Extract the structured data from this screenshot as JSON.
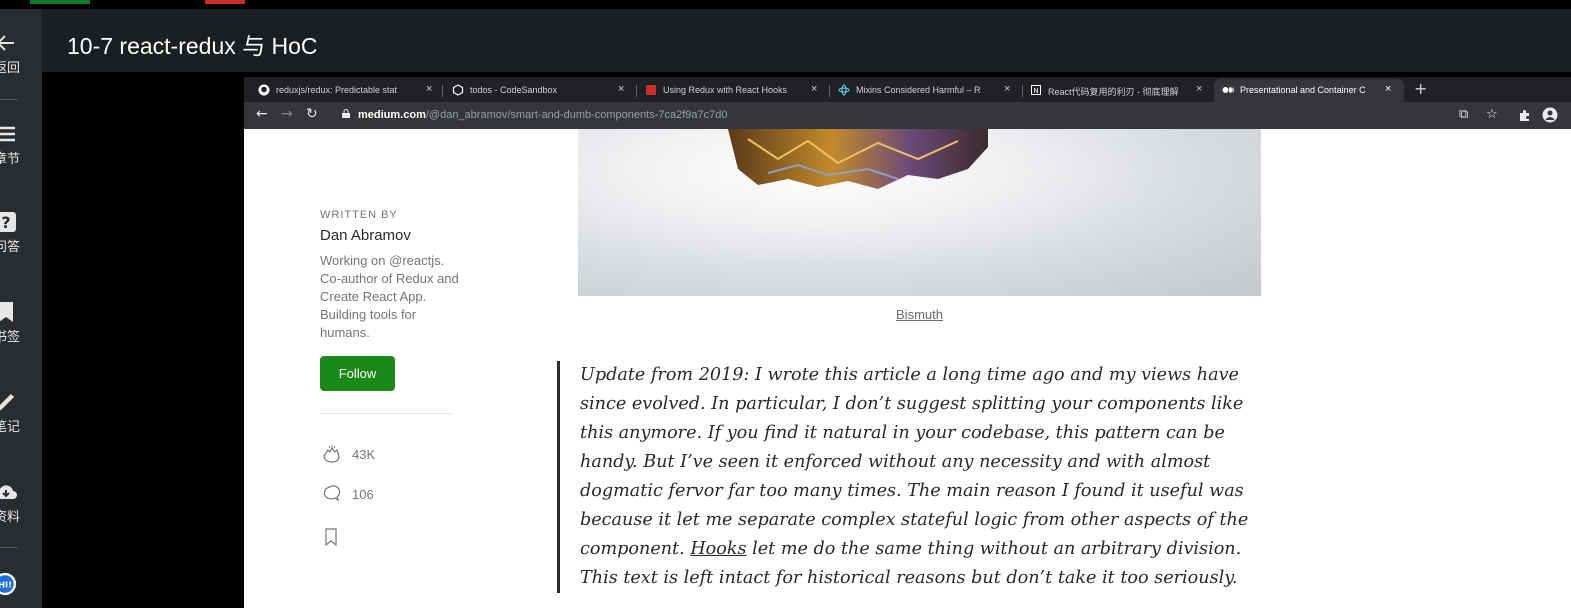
{
  "course": {
    "title": "10-7 react-redux 与 HoC"
  },
  "sidebar": {
    "items": [
      {
        "icon": "arrow-left-icon",
        "label": "返回"
      },
      {
        "icon": "menu-icon",
        "label": "章节"
      },
      {
        "icon": "question-icon",
        "label": "问答"
      },
      {
        "icon": "bookmark-icon",
        "label": "书签"
      },
      {
        "icon": "pencil-icon",
        "label": "笔记"
      },
      {
        "icon": "cloud-download-icon",
        "label": "资料"
      },
      {
        "icon": "hi-icon",
        "label": "HI!"
      }
    ]
  },
  "browser": {
    "tabs": [
      {
        "icon": "github-icon",
        "title": "reduxjs/redux: Predictable stat"
      },
      {
        "icon": "codesandbox-icon",
        "title": "todos - CodeSandbox"
      },
      {
        "icon": "redux-icon",
        "title": "Using Redux with React Hooks"
      },
      {
        "icon": "react-icon",
        "title": "Mixins Considered Harmful – R"
      },
      {
        "icon": "notion-icon",
        "title": "React代码复用的利刃 - 彻底理解"
      },
      {
        "icon": "medium-icon",
        "title": "Presentational and Container C",
        "active": true
      }
    ],
    "url_domain": "medium.com",
    "url_path": "/@dan_abramov/smart-and-dumb-components-7ca2f9a7c7d0"
  },
  "article": {
    "caption": "Bismuth",
    "author": {
      "written_by": "WRITTEN BY",
      "name": "Dan Abramov",
      "bio": "Working on @reactjs. Co-author of Redux and Create React App. Building tools for humans.",
      "follow_label": "Follow"
    },
    "claps": "43K",
    "responses": "106",
    "quote_before": "Update from 2019: I wrote this article a long time ago and my views have since evolved. In particular, I don’t suggest splitting your components like this anymore. If you find it natural in your codebase, this pattern can be handy. But I’ve seen it enforced without any necessity and with almost dogmatic fervor far too many times. The main reason I found it useful was because it let me separate complex stateful logic from other aspects of the component. ",
    "quote_link": "Hooks",
    "quote_after": " let me do the same thing without an arbitrary division. This text is left intact for historical reasons but don’t take it too seriously."
  },
  "colors": {
    "follow": "#1a8917",
    "tabbar": "#202124",
    "addrbar": "#35363a"
  }
}
